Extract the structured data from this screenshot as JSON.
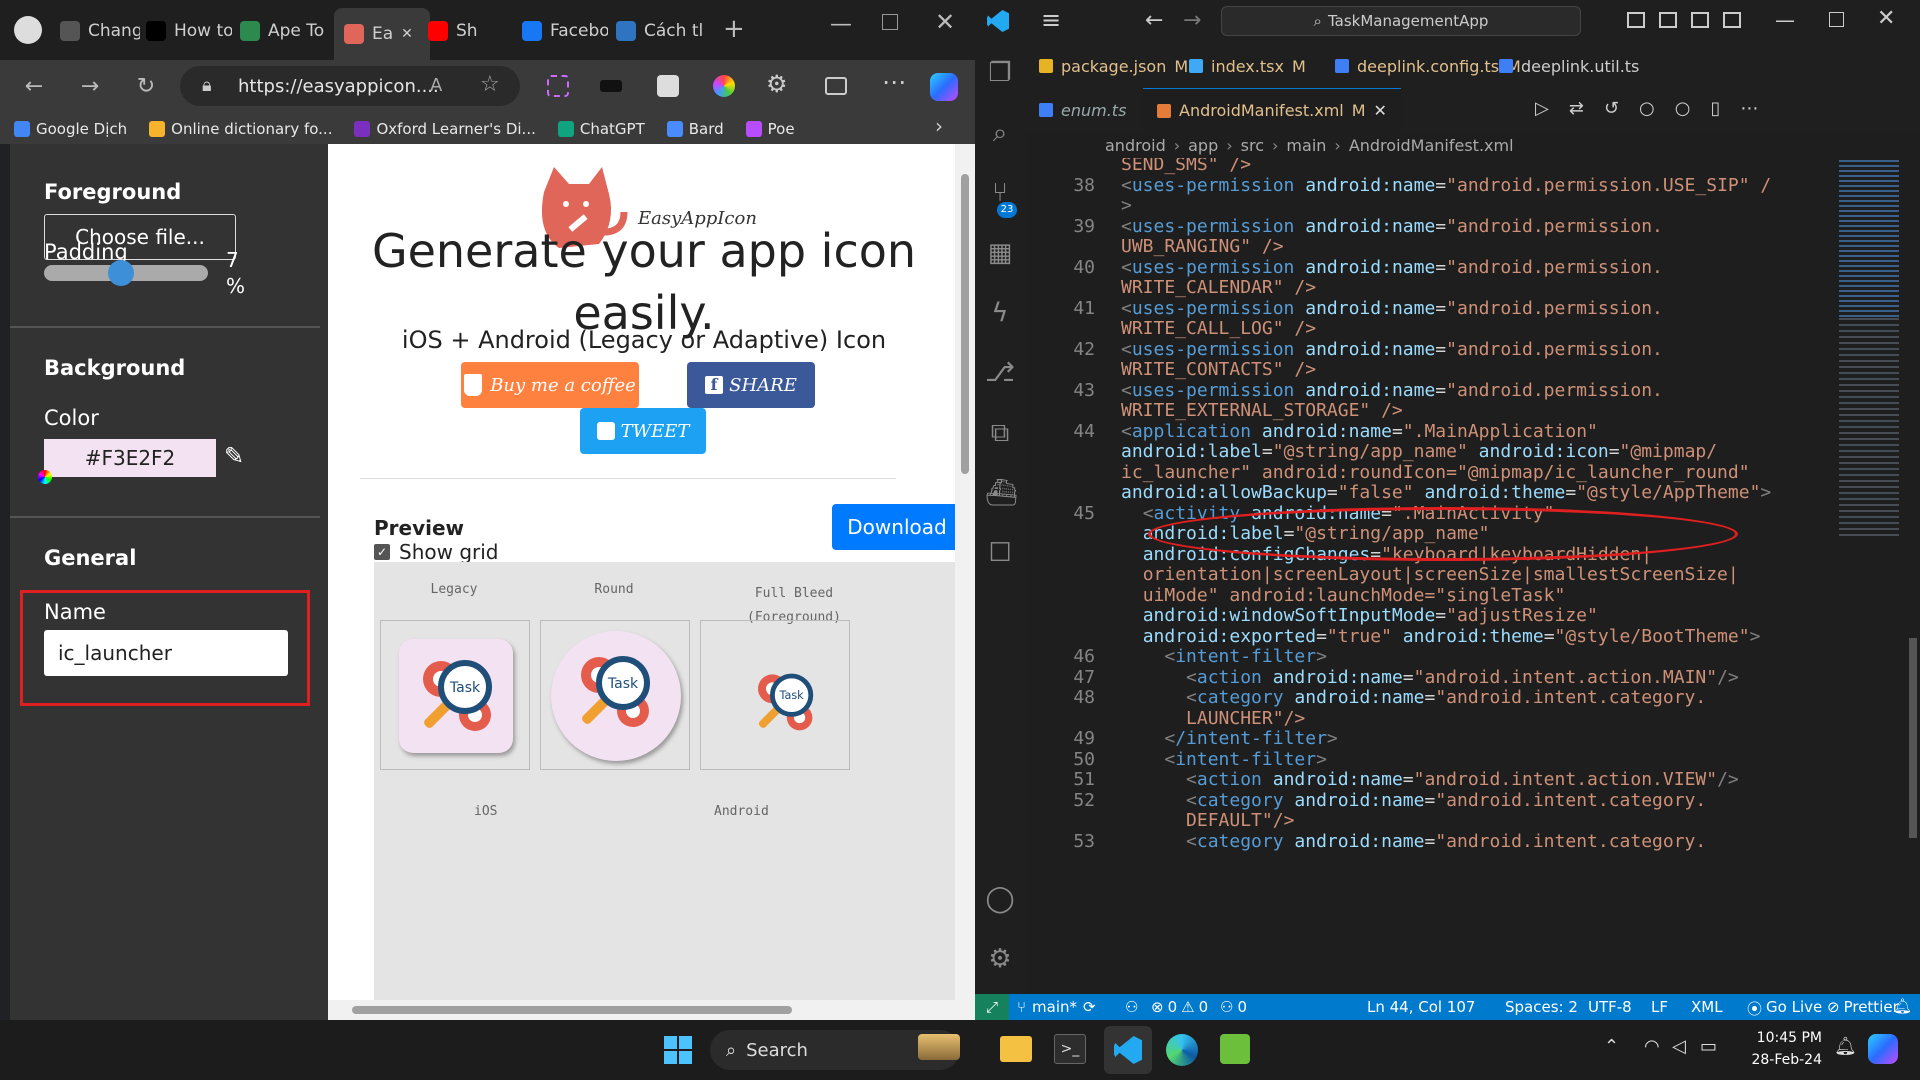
{
  "browser": {
    "tabs": [
      {
        "label": "Change",
        "color": "#555"
      },
      {
        "label": "How to",
        "color": "#000"
      },
      {
        "label": "Ape To",
        "color": "#2d8a4e"
      },
      {
        "label": "Ea",
        "color": "#e0665a"
      },
      {
        "label": "Sh",
        "color": "#ff0000"
      },
      {
        "label": "Facebo",
        "color": "#1877f2"
      },
      {
        "label": "Cách tl",
        "color": "#2f74c0"
      }
    ],
    "url": "https://easyappicon....",
    "bookmarks": [
      "Google Dịch",
      "Online dictionary fo...",
      "Oxford Learner's Di...",
      "ChatGPT",
      "Bard",
      "Poe"
    ]
  },
  "left_panel": {
    "foreground_title": "Foreground",
    "choose_file": "Choose file...",
    "padding_label": "Padding",
    "padding_value": "7",
    "padding_unit": "%",
    "padding_percent": 7,
    "background_title": "Background",
    "color_label": "Color",
    "color_value": "#F3E2F2",
    "general_title": "General",
    "name_label": "Name",
    "name_value": "ic_launcher"
  },
  "page": {
    "logo_text": "EasyAppIcon",
    "headline": "Generate your app icon easily.",
    "subtitle": "iOS + Android (Legacy or Adaptive) Icon",
    "coffee_button": "Buy me a coffee",
    "share_button": "SHARE",
    "tweet_button": "TWEET",
    "preview_title": "Preview",
    "show_grid": "Show grid",
    "download_button": "Download",
    "previews": [
      {
        "label": "Legacy"
      },
      {
        "label": "Round"
      },
      {
        "label": "Full Bleed (Foreground)"
      }
    ],
    "icon_text": "Task",
    "ios_label": "iOS",
    "android_label": "Android"
  },
  "vscode": {
    "search": "TaskManagementApp",
    "tabs_row1": [
      {
        "label": "package.json",
        "mod": "M"
      },
      {
        "label": "index.tsx",
        "mod": "M"
      },
      {
        "label": "deeplink.config.ts",
        "mod": "M"
      },
      {
        "label": "deeplink.util.ts",
        "mod": ""
      }
    ],
    "tabs_row2": [
      {
        "label": "enum.ts",
        "mod": ""
      },
      {
        "label": "AndroidManifest.xml",
        "mod": "M"
      }
    ],
    "breadcrumbs": [
      "android",
      "app",
      "src",
      "main",
      "AndroidManifest.xml"
    ],
    "lines": [
      {
        "n": "",
        "text": "SEND_SMS\" />"
      },
      {
        "n": "38",
        "text": "<uses-permission android:name=\"android.permission.USE_SIP\" /"
      },
      {
        "n": "",
        "text": ">"
      },
      {
        "n": "39",
        "text": "<uses-permission android:name=\"android.permission."
      },
      {
        "n": "",
        "text": "UWB_RANGING\" />"
      },
      {
        "n": "40",
        "text": "<uses-permission android:name=\"android.permission."
      },
      {
        "n": "",
        "text": "WRITE_CALENDAR\" />"
      },
      {
        "n": "41",
        "text": "<uses-permission android:name=\"android.permission."
      },
      {
        "n": "",
        "text": "WRITE_CALL_LOG\" />"
      },
      {
        "n": "42",
        "text": "<uses-permission android:name=\"android.permission."
      },
      {
        "n": "",
        "text": "WRITE_CONTACTS\" />"
      },
      {
        "n": "43",
        "text": "<uses-permission android:name=\"android.permission."
      },
      {
        "n": "",
        "text": "WRITE_EXTERNAL_STORAGE\" />"
      },
      {
        "n": "44",
        "text": "<application android:name=\".MainApplication\""
      },
      {
        "n": "",
        "text": "android:label=\"@string/app_name\" android:icon=\"@mipmap/"
      },
      {
        "n": "",
        "text": "ic_launcher\" android:roundIcon=\"@mipmap/ic_launcher_round\""
      },
      {
        "n": "",
        "text": "android:allowBackup=\"false\" android:theme=\"@style/AppTheme\">"
      },
      {
        "n": "45",
        "text": "  <activity android:name=\".MainActivity\""
      },
      {
        "n": "",
        "text": "  android:label=\"@string/app_name\""
      },
      {
        "n": "",
        "text": "  android:configChanges=\"keyboard|keyboardHidden|"
      },
      {
        "n": "",
        "text": "  orientation|screenLayout|screenSize|smallestScreenSize|"
      },
      {
        "n": "",
        "text": "  uiMode\" android:launchMode=\"singleTask\""
      },
      {
        "n": "",
        "text": "  android:windowSoftInputMode=\"adjustResize\""
      },
      {
        "n": "",
        "text": "  android:exported=\"true\" android:theme=\"@style/BootTheme\">"
      },
      {
        "n": "46",
        "text": "    <intent-filter>"
      },
      {
        "n": "47",
        "text": "      <action android:name=\"android.intent.action.MAIN\"/>"
      },
      {
        "n": "48",
        "text": "      <category android:name=\"android.intent.category."
      },
      {
        "n": "",
        "text": "      LAUNCHER\"/>"
      },
      {
        "n": "49",
        "text": "    </intent-filter>"
      },
      {
        "n": "50",
        "text": "    <intent-filter>"
      },
      {
        "n": "51",
        "text": "      <action android:name=\"android.intent.action.VIEW\"/>"
      },
      {
        "n": "52",
        "text": "      <category android:name=\"android.intent.category."
      },
      {
        "n": "",
        "text": "      DEFAULT\"/>"
      },
      {
        "n": "53",
        "text": "      <category android:name=\"android.intent.category."
      }
    ],
    "status": {
      "branch": "main*",
      "errors": "0",
      "warnings": "0",
      "ports": "0",
      "position": "Ln 44, Col 107",
      "spaces": "Spaces: 2",
      "encoding": "UTF-8",
      "eol": "LF",
      "language": "XML",
      "golive": "Go Live",
      "prettier": "Prettier"
    },
    "badge_count": "23"
  },
  "taskbar": {
    "search": "Search",
    "time": "10:45 PM",
    "date": "28-Feb-24"
  },
  "colors": {
    "accent": "#007acc",
    "highlight_red": "#e02020",
    "coffee": "#ff813f",
    "share": "#3b5998",
    "tweet": "#1da1f2",
    "download": "#007bff"
  }
}
